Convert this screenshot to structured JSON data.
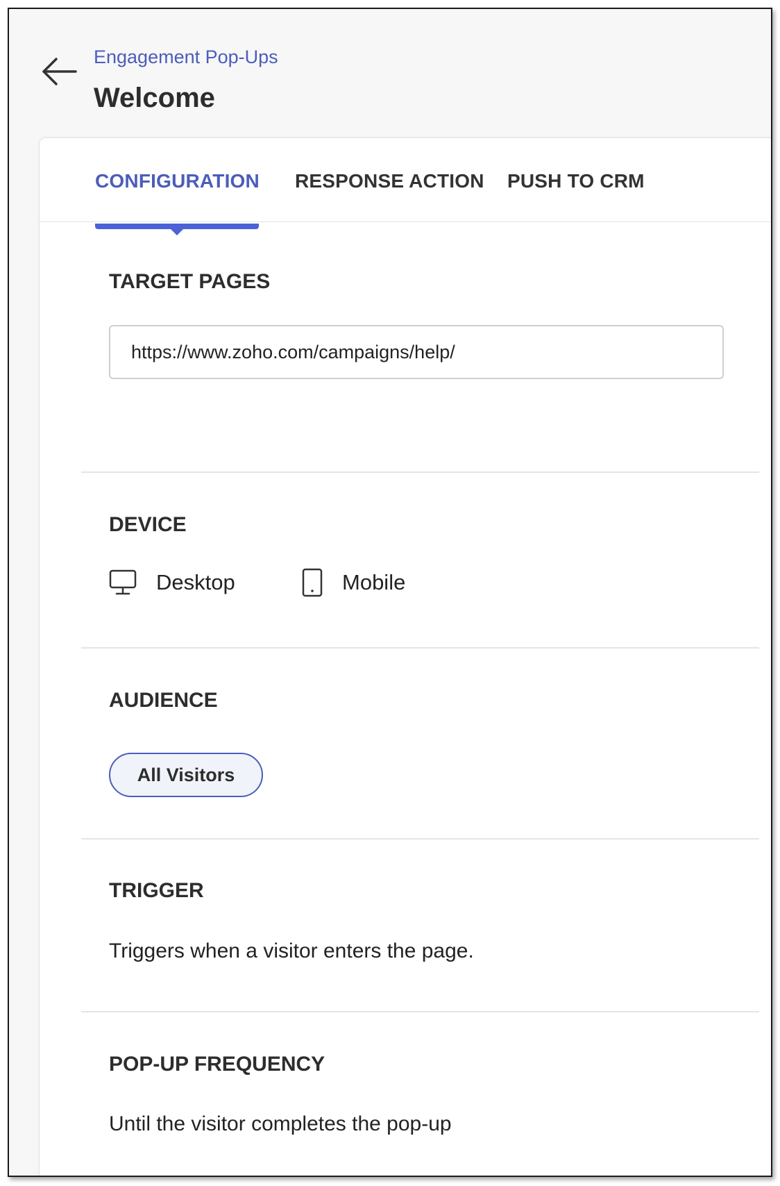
{
  "header": {
    "breadcrumb": "Engagement Pop-Ups",
    "title": "Welcome",
    "back_icon": "arrow-left-icon"
  },
  "tabs": [
    {
      "label": "CONFIGURATION",
      "active": true
    },
    {
      "label": "RESPONSE ACTION",
      "active": false
    },
    {
      "label": "PUSH TO CRM",
      "active": false
    }
  ],
  "target_pages": {
    "title": "TARGET PAGES",
    "url_value": "https://www.zoho.com/campaigns/help/"
  },
  "device": {
    "title": "DEVICE",
    "options": [
      {
        "label": "Desktop",
        "icon": "desktop-icon"
      },
      {
        "label": "Mobile",
        "icon": "mobile-icon"
      }
    ]
  },
  "audience": {
    "title": "AUDIENCE",
    "selected": "All Visitors"
  },
  "trigger": {
    "title": "TRIGGER",
    "description": "Triggers when a visitor enters the page."
  },
  "frequency": {
    "title": "POP-UP FREQUENCY",
    "description": "Until the visitor completes the pop-up"
  },
  "colors": {
    "accent": "#4b5dbb",
    "tab_indicator": "#4b63d6",
    "text": "#2d2d2d"
  }
}
